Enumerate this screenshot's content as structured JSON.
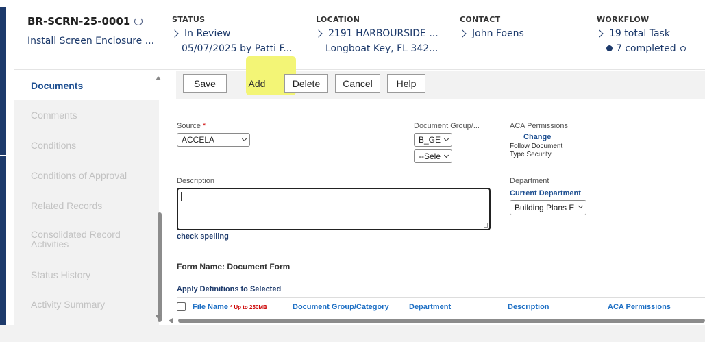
{
  "header": {
    "record_id": "BR-SCRN-25-0001",
    "record_name": "Install Screen Enclosure ...",
    "status": {
      "label": "STATUS",
      "value": "In Review",
      "detail": "05/07/2025 by Patti F..."
    },
    "location": {
      "label": "LOCATION",
      "value": "2191 HARBOURSIDE ...",
      "detail": "Longboat Key, FL 342..."
    },
    "contact": {
      "label": "CONTACT",
      "value": "John Foens"
    },
    "workflow": {
      "label": "WORKFLOW",
      "value": "19 total Task",
      "detail": "7 completed"
    }
  },
  "nav": {
    "items": [
      {
        "label": "Documents"
      },
      {
        "label": "Comments"
      },
      {
        "label": "Conditions"
      },
      {
        "label": "Conditions of Approval"
      },
      {
        "label": "Related Records"
      },
      {
        "label": "Consolidated Record",
        "label2": "Activities"
      },
      {
        "label": "Status History"
      },
      {
        "label": "Activity Summary"
      }
    ]
  },
  "toolbar": {
    "save": "Save",
    "add": "Add",
    "delete": "Delete",
    "cancel": "Cancel",
    "help": "Help"
  },
  "form": {
    "source_label": "Source",
    "required_mark": "*",
    "source_value": "ACCELA",
    "doc_group_label": "Document Group/...",
    "doc_group_value": "B_GE",
    "doc_category_value": "--Sele",
    "aca_label": "ACA Permissions",
    "aca_change": "Change",
    "aca_text1": "Follow Document",
    "aca_text2": "Type Security",
    "description_label": "Description",
    "description_value": "",
    "department_label": "Department",
    "current_department": "Current Department",
    "department_value": "Building Plans E",
    "check_spelling": "check spelling",
    "form_name": "Form Name: Document Form",
    "apply_definitions": "Apply Definitions to Selected"
  },
  "grid": {
    "columns": [
      "File Name",
      "Document Group/Category",
      "Department",
      "Description",
      "ACA Permissions"
    ],
    "file_note": "* Up to 250MB"
  },
  "colors": {
    "brand": "#1d3a6b",
    "link": "#1d6fc4",
    "highlight": "#f3f576"
  }
}
